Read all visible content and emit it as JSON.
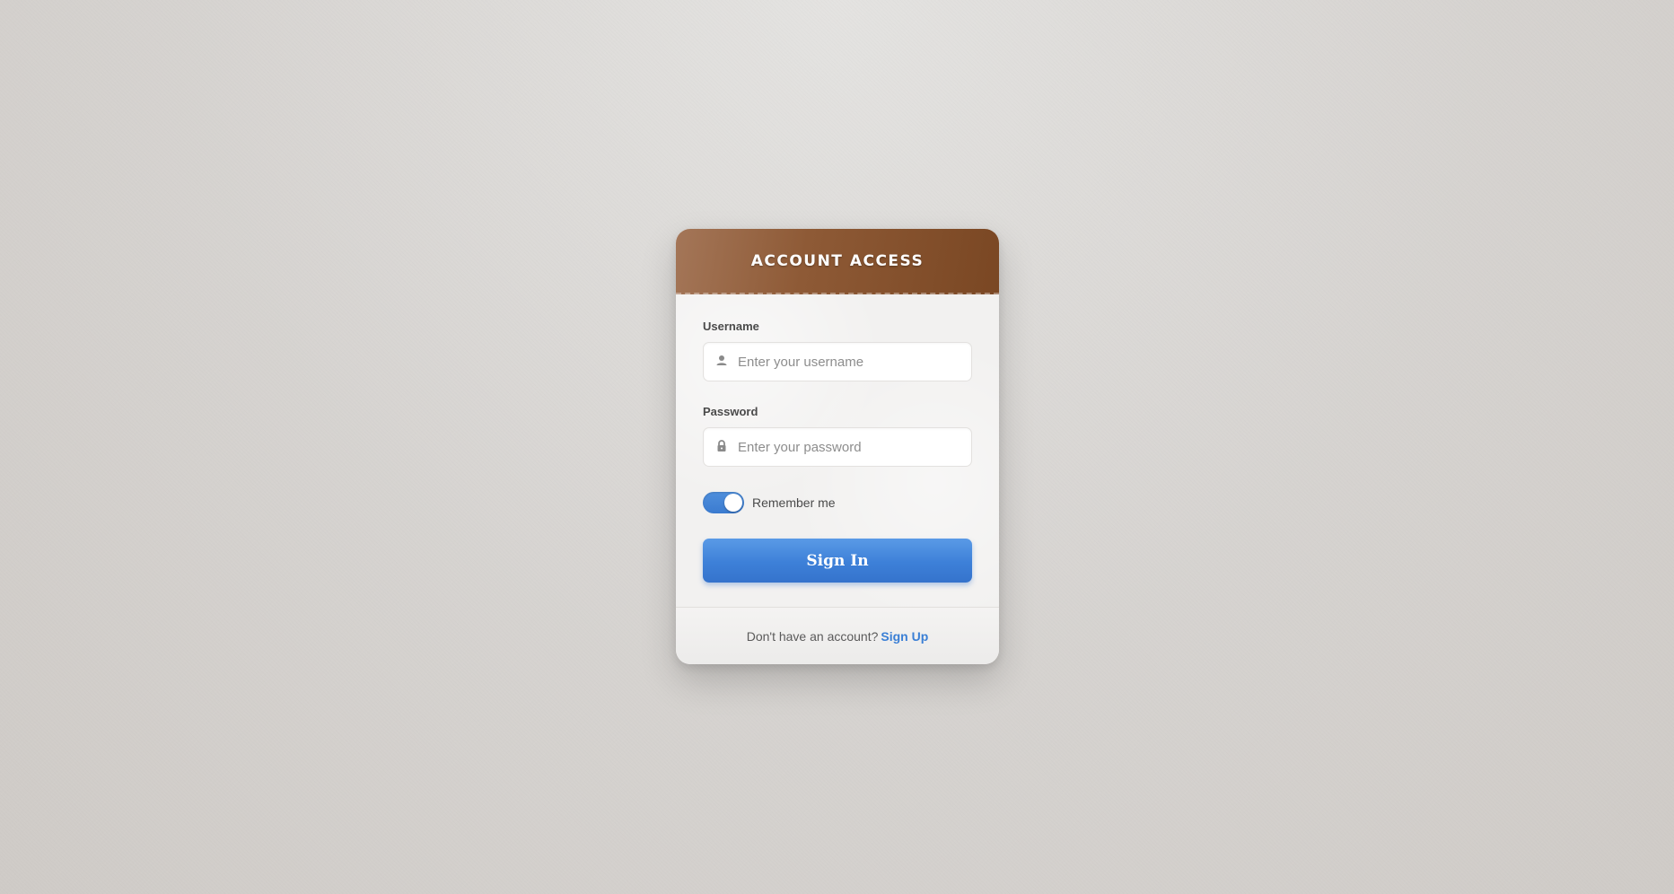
{
  "header": {
    "title": "ACCOUNT ACCESS"
  },
  "form": {
    "username": {
      "label": "Username",
      "placeholder": "Enter your username",
      "value": "",
      "icon": "user-icon"
    },
    "password": {
      "label": "Password",
      "placeholder": "Enter your password",
      "value": "",
      "icon": "lock-icon"
    },
    "remember": {
      "label": "Remember me",
      "checked": true
    },
    "submit_label": "Sign In"
  },
  "footer": {
    "prompt": "Don't have an account?",
    "link_label": "Sign Up"
  },
  "colors": {
    "header_brown": "#7a4723",
    "accent_blue": "#3d80d8",
    "link_blue": "#3a7fd5"
  }
}
